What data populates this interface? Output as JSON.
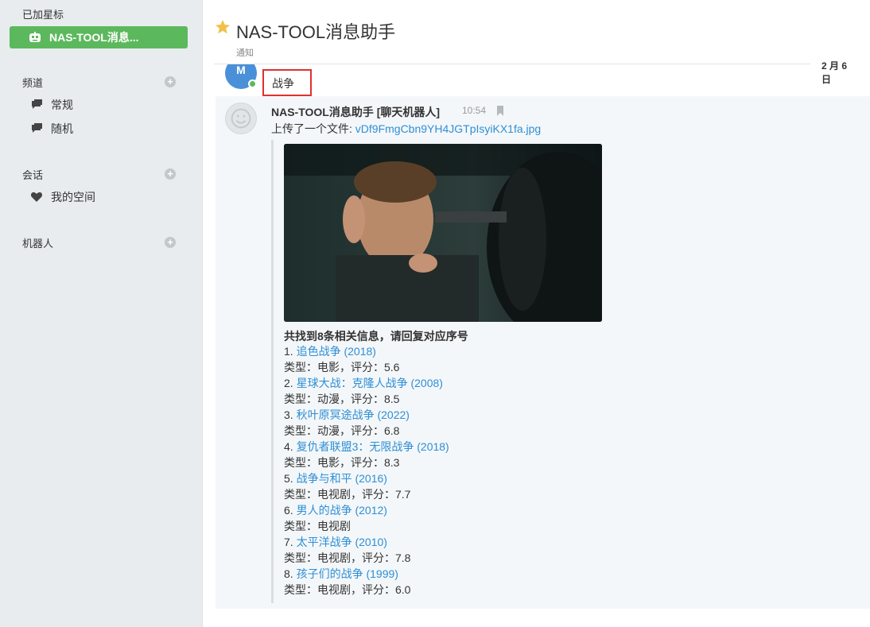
{
  "sidebar": {
    "starred_title": "已加星标",
    "starred_item": "NAS-TOOL消息...",
    "channels_title": "频道",
    "channels": [
      {
        "label": "常规",
        "icon": "chat-bubble-icon"
      },
      {
        "label": "随机",
        "icon": "chat-bubble-icon"
      }
    ],
    "conversations_title": "会话",
    "conversations": [
      {
        "label": "我的空间",
        "icon": "heart-icon"
      }
    ],
    "bots_title": "机器人"
  },
  "header": {
    "title": "NAS-TOOL消息助手",
    "subtitle": "通知"
  },
  "date_divider": "2 月 6 日",
  "user_message": {
    "avatar_letter": "M",
    "text": "战争"
  },
  "bot_post": {
    "name": "NAS-TOOL消息助手 [聊天机器人]",
    "time": "10:54",
    "upload_prefix": "上传了一个文件: ",
    "file_name": "vDf9FmgCbn9YH4JGTpIsyiKX1fa.jpg",
    "result_header": "共找到8条相关信息，请回复对应序号",
    "results": [
      {
        "num": "1.",
        "title": "追色战争 (2018)",
        "info": "类型：电影，评分：5.6"
      },
      {
        "num": "2.",
        "title": "星球大战：克隆人战争 (2008)",
        "info": "类型：动漫，评分：8.5"
      },
      {
        "num": "3.",
        "title": "秋叶原冥途战争 (2022)",
        "info": "类型：动漫，评分：6.8"
      },
      {
        "num": "4.",
        "title": "复仇者联盟3：无限战争 (2018)",
        "info": "类型：电影，评分：8.3"
      },
      {
        "num": "5.",
        "title": "战争与和平 (2016)",
        "info": "类型：电视剧，评分：7.7"
      },
      {
        "num": "6.",
        "title": "男人的战争 (2012)",
        "info": "类型：电视剧"
      },
      {
        "num": "7.",
        "title": "太平洋战争 (2010)",
        "info": "类型：电视剧，评分：7.8"
      },
      {
        "num": "8.",
        "title": "孩子们的战争 (1999)",
        "info": "类型：电视剧，评分：6.0"
      }
    ]
  }
}
